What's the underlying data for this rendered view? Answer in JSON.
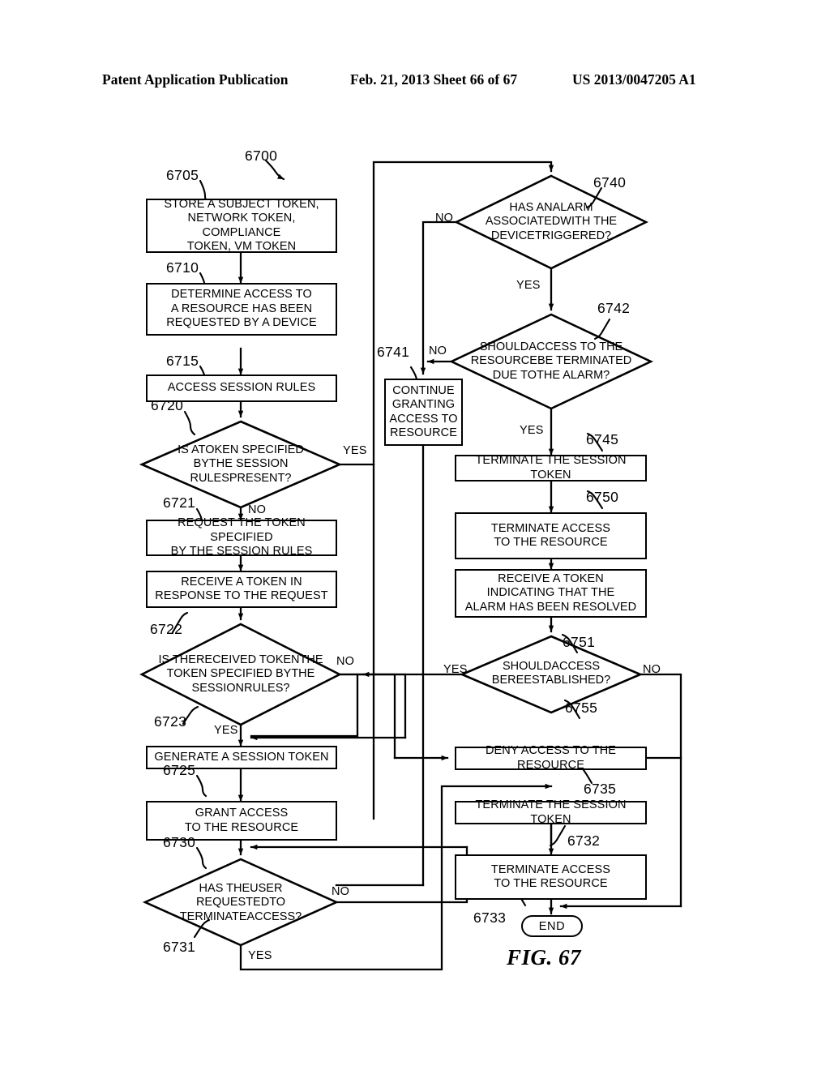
{
  "header": {
    "publication": "Patent Application Publication",
    "date_sheet": "Feb. 21, 2013  Sheet 66 of 67",
    "patent_number": "US 2013/0047205 A1"
  },
  "figure": {
    "caption": "FIG. 67",
    "flow_numeral": "6700"
  },
  "nodes": {
    "n6705": {
      "ref": "6705",
      "type": "process",
      "text": "STORE A SUBJECT TOKEN, NETWORK TOKEN, COMPLIANCE TOKEN, VM TOKEN",
      "lines": [
        "STORE A SUBJECT TOKEN,",
        "NETWORK TOKEN, COMPLIANCE",
        "TOKEN, VM TOKEN"
      ]
    },
    "n6710": {
      "ref": "6710",
      "type": "process",
      "text": "DETERMINE ACCESS TO A RESOURCE HAS BEEN REQUESTED BY A DEVICE",
      "lines": [
        "DETERMINE ACCESS TO",
        "A RESOURCE HAS BEEN",
        "REQUESTED BY A DEVICE"
      ]
    },
    "n6715": {
      "ref": "6715",
      "type": "process",
      "text": "ACCESS SESSION RULES",
      "lines": [
        "ACCESS SESSION RULES"
      ]
    },
    "n6720": {
      "ref": "6720",
      "type": "decision",
      "text": "IS A TOKEN SPECIFIED BY THE SESSION RULES PRESENT?",
      "lines": [
        "IS A",
        "TOKEN SPECIFIED BY",
        "THE SESSION RULES",
        "PRESENT?"
      ],
      "yes_label": "YES",
      "no_label": "NO"
    },
    "n6721": {
      "ref": "6721",
      "type": "process",
      "text": "REQUEST THE TOKEN SPECIFIED BY THE SESSION RULES",
      "lines": [
        "REQUEST THE TOKEN SPECIFIED",
        "BY THE SESSION RULES"
      ]
    },
    "n6721b": {
      "ref": "",
      "type": "process",
      "text": "RECEIVE A TOKEN IN RESPONSE TO THE REQUEST",
      "lines": [
        "RECEIVE A TOKEN IN",
        "RESPONSE TO THE REQUEST"
      ]
    },
    "n6722": {
      "ref": "6722",
      "type": "decision",
      "text": "IS THE RECEIVED TOKEN THE TOKEN SPECIFIED BY THE SESSION RULES?",
      "lines": [
        "IS THE",
        "RECEIVED TOKEN",
        "THE TOKEN SPECIFIED BY",
        "THE SESSION",
        "RULES?"
      ],
      "yes_label": "YES",
      "no_label": "NO"
    },
    "n6723": {
      "ref": "6723",
      "type": "process",
      "text": "GENERATE A SESSION TOKEN",
      "lines": [
        "GENERATE A SESSION TOKEN"
      ]
    },
    "n6725": {
      "ref": "6725",
      "type": "process",
      "text": "GRANT ACCESS TO THE RESOURCE",
      "lines": [
        "GRANT ACCESS",
        "TO THE RESOURCE"
      ]
    },
    "n6730": {
      "ref": "6730",
      "type": "decision",
      "text": "HAS THE USER REQUESTED TO TERMINATE ACCESS?",
      "lines": [
        "HAS THE",
        "USER REQUESTED",
        "TO TERMINATE",
        "ACCESS?"
      ],
      "yes_label": "YES",
      "no_label": "NO"
    },
    "n6731": {
      "ref": "6731",
      "type": "label-only",
      "text": ""
    },
    "n6740": {
      "ref": "6740",
      "type": "decision",
      "text": "HAS AN ALARM ASSOCIATED WITH THE DEVICE TRIGGERED?",
      "lines": [
        "HAS AN",
        "ALARM ASSOCIATED",
        "WITH THE DEVICE",
        "TRIGGERED?"
      ],
      "yes_label": "YES",
      "no_label": "NO"
    },
    "n6742": {
      "ref": "6742",
      "type": "decision",
      "text": "SHOULD ACCESS TO THE RESOURCE BE TERMINATED DUE TO THE ALARM?",
      "lines": [
        "SHOULD",
        "ACCESS TO THE RESOURCE",
        "BE TERMINATED DUE TO",
        "THE ALARM?"
      ],
      "yes_label": "YES",
      "no_label": "NO"
    },
    "n6741": {
      "ref": "6741",
      "type": "process",
      "text": "CONTINUE GRANTING ACCESS TO RESOURCE",
      "lines": [
        "CONTINUE",
        "GRANTING",
        "ACCESS TO",
        "RESOURCE"
      ]
    },
    "n6745": {
      "ref": "6745",
      "type": "process",
      "text": "TERMINATE THE SESSION TOKEN",
      "lines": [
        "TERMINATE THE SESSION TOKEN"
      ]
    },
    "n6750": {
      "ref": "6750",
      "type": "process",
      "text": "TERMINATE ACCESS TO THE RESOURCE",
      "lines": [
        "TERMINATE ACCESS",
        "TO THE RESOURCE"
      ]
    },
    "n6750b": {
      "ref": "",
      "type": "process",
      "text": "RECEIVE A TOKEN INDICATING THAT THE ALARM HAS BEEN RESOLVED",
      "lines": [
        "RECEIVE A TOKEN",
        "INDICATING THAT THE",
        "ALARM HAS BEEN RESOLVED"
      ]
    },
    "n6751": {
      "ref": "6751",
      "type": "decision",
      "text": "SHOULD ACCESS BE REESTABLISHED?",
      "lines": [
        "SHOULD",
        "ACCESS BE",
        "REESTABLISHED?"
      ],
      "yes_label": "YES",
      "no_label": "NO"
    },
    "n6755": {
      "ref": "6755",
      "type": "process",
      "text": "DENY ACCESS TO THE RESOURCE",
      "lines": [
        "DENY ACCESS TO THE RESOURCE"
      ]
    },
    "n6735": {
      "ref": "6735",
      "type": "process",
      "text": "TERMINATE THE SESSION TOKEN",
      "lines": [
        "TERMINATE THE SESSION TOKEN"
      ]
    },
    "n6732": {
      "ref": "6732",
      "type": "process",
      "text": "TERMINATE ACCESS TO THE RESOURCE",
      "lines": [
        "TERMINATE ACCESS",
        "TO THE RESOURCE"
      ]
    },
    "n6733": {
      "ref": "6733",
      "type": "terminator",
      "text": "END"
    }
  },
  "branch_labels": {
    "b6720_yes": "YES",
    "b6720_no": "NO",
    "b6722_no": "NO",
    "b6722_yes": "YES",
    "b6730_no": "NO",
    "b6730_yes": "YES",
    "b6740_no": "NO",
    "b6740_yes": "YES",
    "b6742_no": "NO",
    "b6742_yes": "YES",
    "b6751_yes": "YES",
    "b6751_no": "NO"
  },
  "refs": {
    "r6700": "6700",
    "r6705": "6705",
    "r6710": "6710",
    "r6715": "6715",
    "r6720": "6720",
    "r6721": "6721",
    "r6722": "6722",
    "r6723": "6723",
    "r6725": "6725",
    "r6730": "6730",
    "r6731": "6731",
    "r6732": "6732",
    "r6733": "6733",
    "r6735": "6735",
    "r6740": "6740",
    "r6741": "6741",
    "r6742": "6742",
    "r6745": "6745",
    "r6750": "6750",
    "r6751": "6751",
    "r6755": "6755"
  },
  "colors": {
    "ink": "#000000",
    "paper": "#ffffff"
  }
}
